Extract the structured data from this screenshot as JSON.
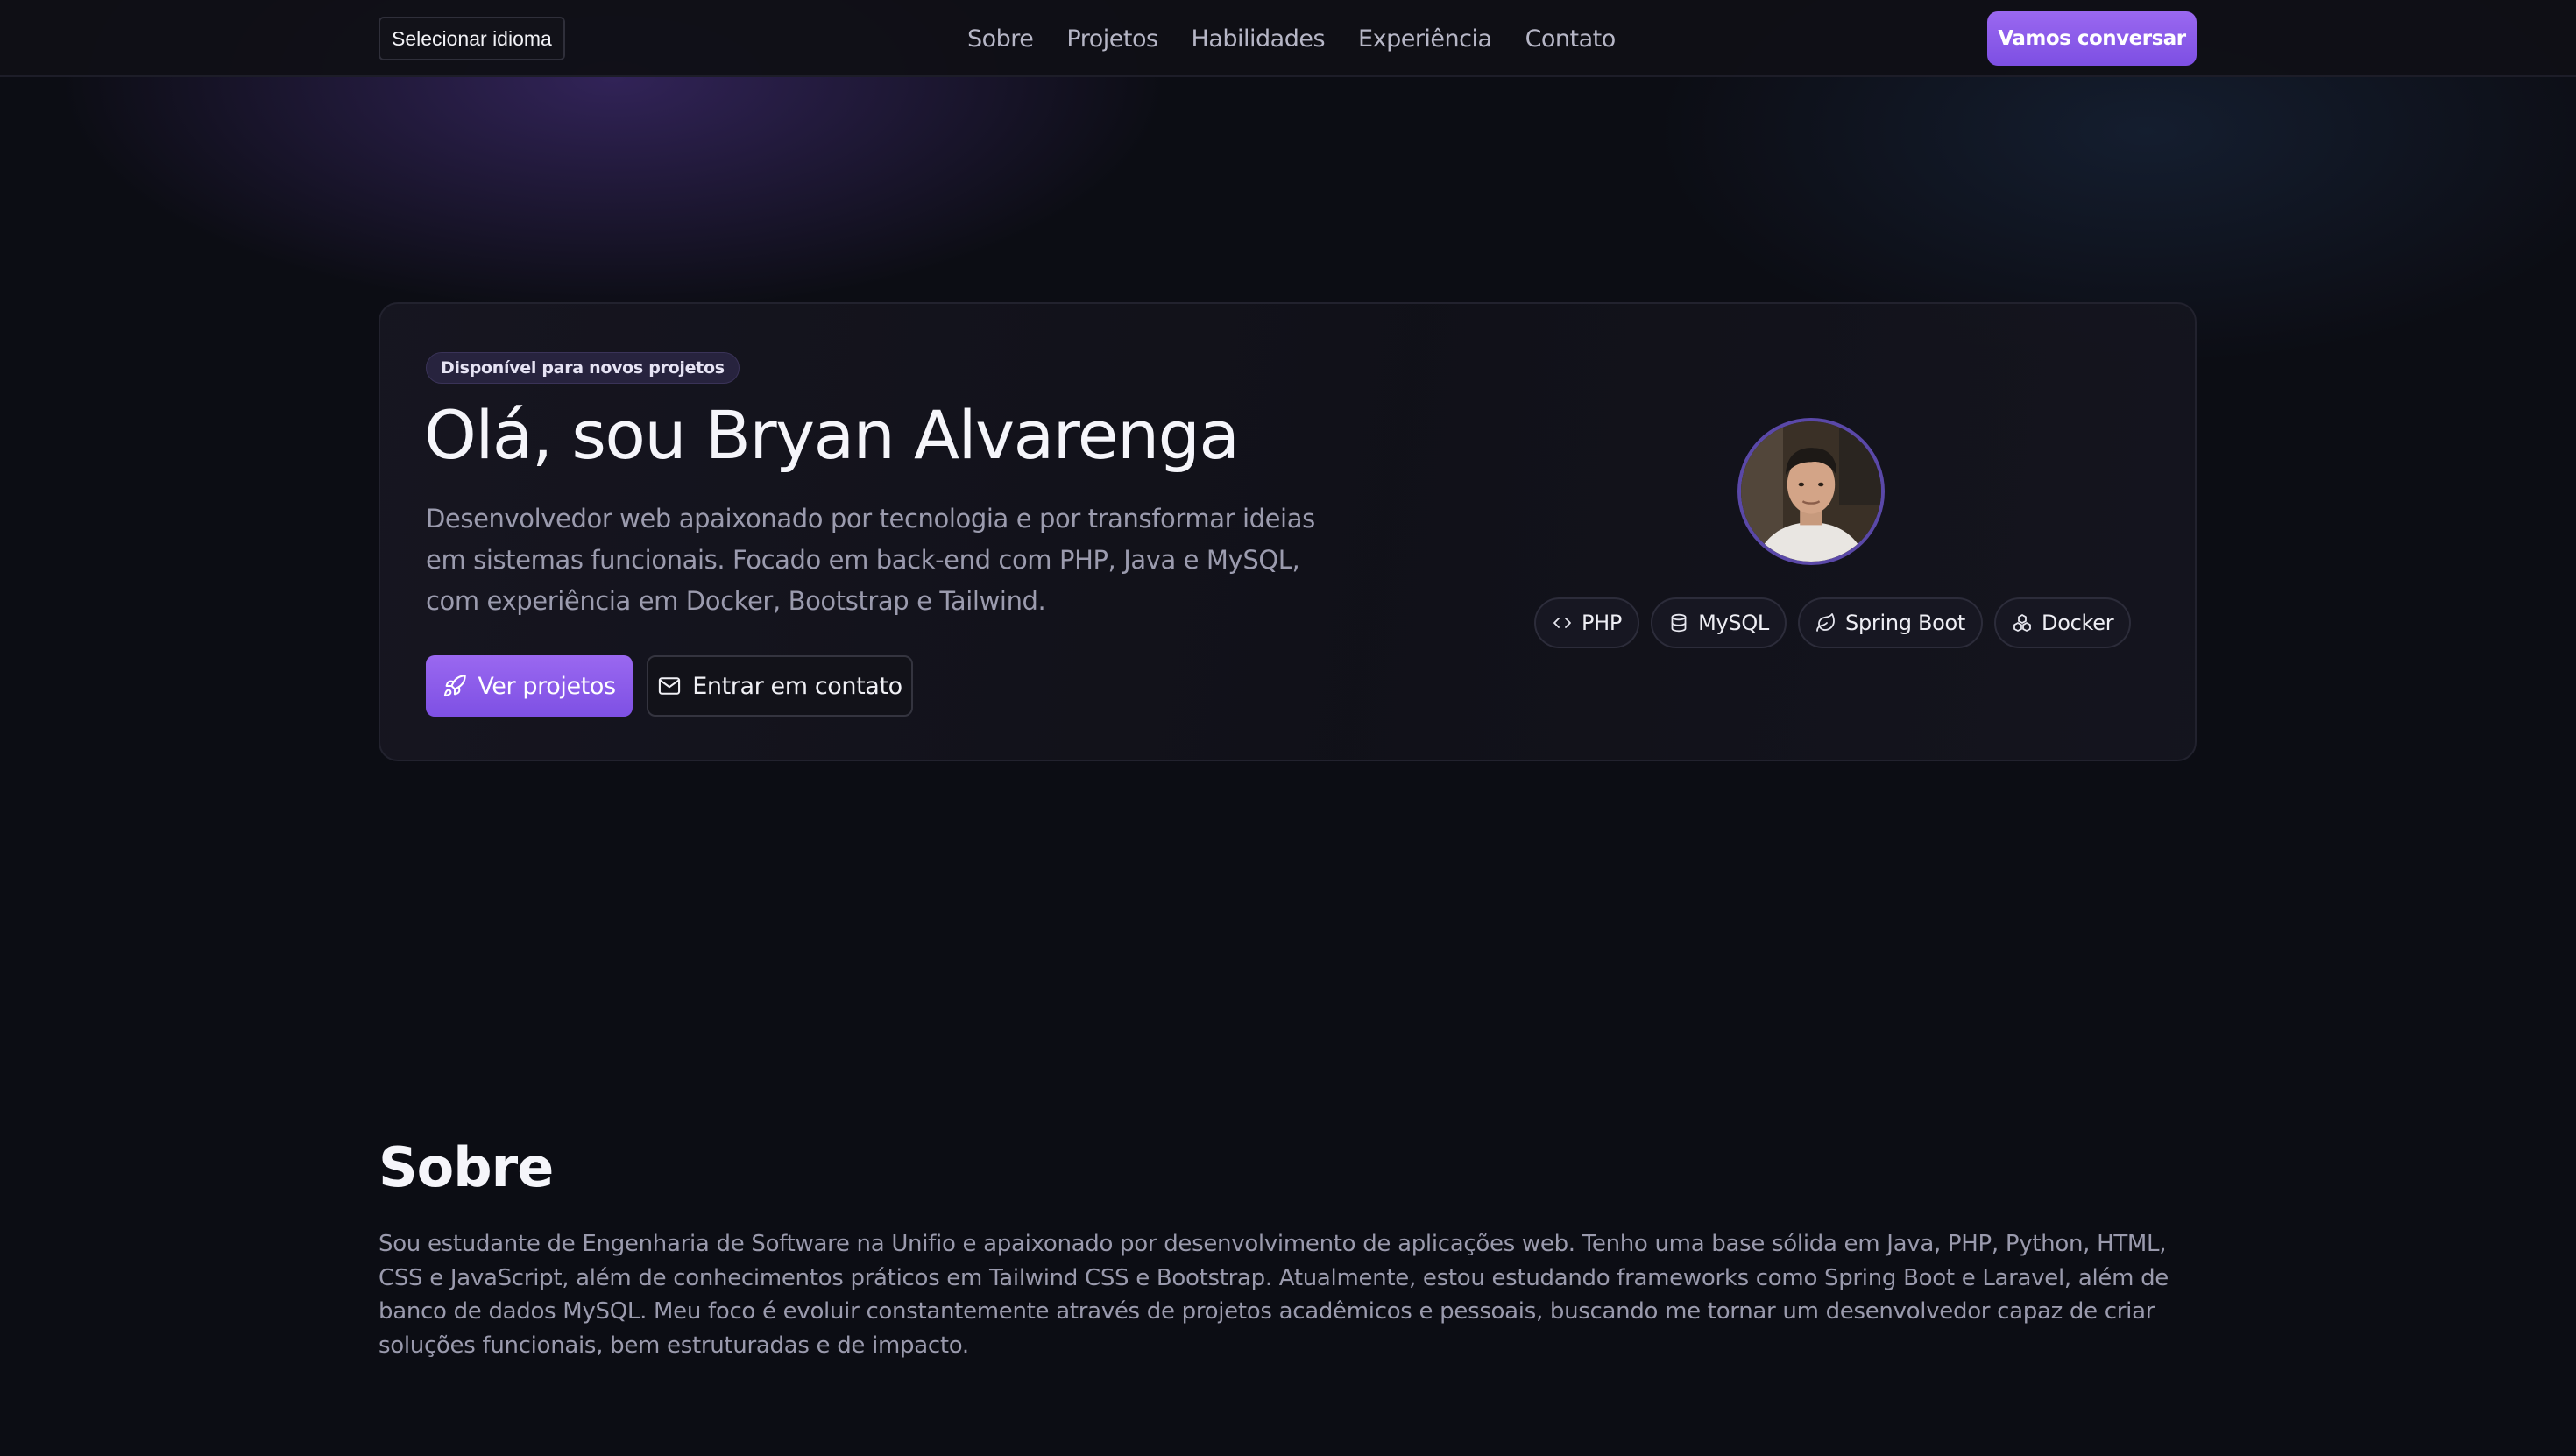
{
  "nav": {
    "language_select": "Selecionar idioma",
    "links": [
      "Sobre",
      "Projetos",
      "Habilidades",
      "Experiência",
      "Contato"
    ],
    "cta": "Vamos conversar"
  },
  "hero": {
    "badge": "Disponível para novos projetos",
    "title": "Olá, sou Bryan Alvarenga",
    "description": "Desenvolvedor web apaixonado por tecnologia e por transformar ideias em sistemas funcionais. Focado em back-end com PHP, Java e MySQL, com experiência em Docker, Bootstrap e Tailwind.",
    "primary_button": "Ver projetos",
    "secondary_button": "Entrar em contato",
    "chips": [
      {
        "label": "PHP",
        "icon": "code-icon"
      },
      {
        "label": "MySQL",
        "icon": "database-icon"
      },
      {
        "label": "Spring Boot",
        "icon": "leaf-icon"
      },
      {
        "label": "Docker",
        "icon": "boxes-icon"
      }
    ]
  },
  "about": {
    "title": "Sobre",
    "text": "Sou estudante de Engenharia de Software na Unifio e apaixonado por desenvolvimento de aplicações web. Tenho uma base sólida em Java, PHP, Python, HTML, CSS e JavaScript, além de conhecimentos práticos em Tailwind CSS e Bootstrap. Atualmente, estou estudando frameworks como Spring Boot e Laravel, além de banco de dados MySQL. Meu foco é evoluir constantemente através de projetos acadêmicos e pessoais, buscando me tornar um desenvolvedor capaz de criar soluções funcionais, bem estruturadas e de impacto."
  },
  "colors": {
    "accent": "#8b5cf6",
    "background": "#0c0d14",
    "muted_text": "#9b9bae"
  }
}
